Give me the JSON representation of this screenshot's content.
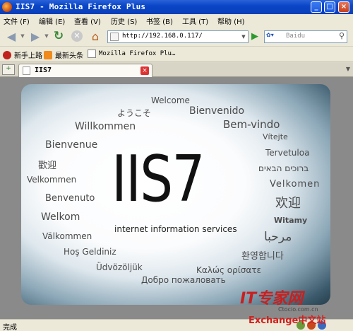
{
  "window": {
    "title": "IIS7 - Mozilla Firefox Plus"
  },
  "menu": [
    "文件 (F)",
    "编辑 (E)",
    "查看 (V)",
    "历史 (S)",
    "书签 (B)",
    "工具 (T)",
    "帮助 (H)"
  ],
  "nav": {
    "url": "http://192.168.0.117/",
    "search_placeholder": "Baidu"
  },
  "bookmarks": [
    "新手上路",
    "最新头条",
    "Mozilla Firefox Plu…"
  ],
  "tab": {
    "label": "IIS7"
  },
  "content": {
    "logo": "IIS7",
    "subtitle": "internet information services",
    "greetings": [
      "Welcome",
      "ようこそ",
      "Bienvenido",
      "Willkommen",
      "Bem-vindo",
      "Vítejte",
      "Bienvenue",
      "Tervetuloa",
      "歡迎",
      "ברוכים הבאים",
      "Velkommen",
      "Velkomen",
      "Benvenuto",
      "欢迎",
      "Welkom",
      "Witamy",
      "Välkommen",
      "مرحبا",
      "Hoş Geldiniz",
      "환영합니다",
      "Üdvözöljük",
      "Καλώς ορίσατε",
      "Добро пожаловать"
    ]
  },
  "status": {
    "text": "完成"
  },
  "watermark": {
    "logo": "IT专家网",
    "url": "Ctocio.com.cn",
    "sub": "Exchange中文站"
  },
  "colors": {
    "titlebar": "#0a46c8",
    "watermark_red": "#c8201f"
  }
}
